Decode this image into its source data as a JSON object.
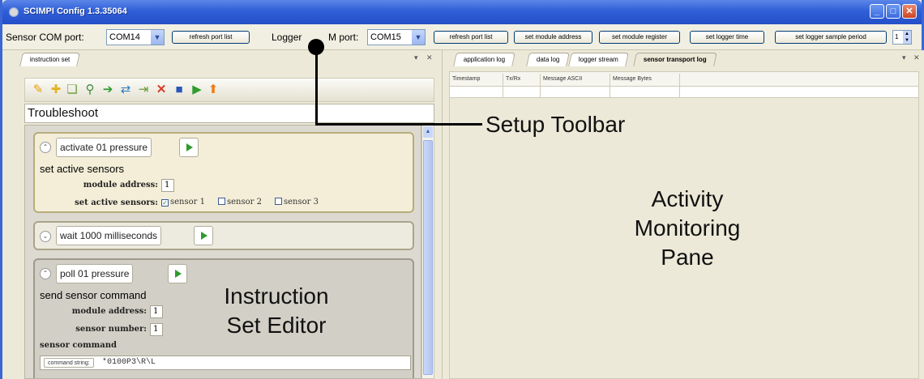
{
  "window": {
    "title": "SCIMPI Config  1.3.35064",
    "minimize": "_",
    "maximize": "□",
    "close": "✕"
  },
  "toolbar": {
    "sensor_port_label": "Sensor COM port:",
    "sensor_port_value": "COM14",
    "refresh1": "refresh port list",
    "logger_port_label_a": "Logger",
    "logger_port_label_b": "M port:",
    "logger_port_value": "COM15",
    "refresh2": "refresh port list",
    "set_module_address": "set module address",
    "set_module_register": "set module register",
    "set_logger_time": "set logger time",
    "set_logger_sample_period": "set logger sample period",
    "sample_period_value": "1"
  },
  "left_pane": {
    "tab": "instruction set",
    "pin": "▾",
    "close": "✕",
    "problem_name": "Troubleshoot",
    "instructions": [
      {
        "name": "activate 01 pressure",
        "type": "set active sensors",
        "module_address_label": "module address:",
        "module_address": "1",
        "active_sensors_label": "set active sensors:",
        "sensors": [
          {
            "label": "sensor 1",
            "checked": true
          },
          {
            "label": "sensor 2",
            "checked": false
          },
          {
            "label": "sensor 3",
            "checked": false
          }
        ],
        "collapse": "⌃"
      },
      {
        "name": "wait 1000 milliseconds",
        "collapse": "⌄"
      },
      {
        "name": "poll 01 pressure",
        "type": "send sensor command",
        "module_address_label": "module address:",
        "module_address": "1",
        "sensor_number_label": "sensor number:",
        "sensor_number": "1",
        "sensor_command_label": "sensor command",
        "command_string_label": "command string:",
        "command_string": "*0100P3\\R\\L",
        "collapse": "⌃"
      }
    ]
  },
  "right_pane": {
    "tabs": [
      "application log",
      "data log",
      "logger stream",
      "sensor transport log"
    ],
    "active_tab": 3,
    "pin": "▾",
    "close": "✕",
    "columns": [
      "Timestamp",
      "Tx/Rx",
      "Message ASCII",
      "Message Bytes"
    ]
  },
  "annotations": {
    "setup_toolbar": "Setup Toolbar",
    "activity_pane": [
      "Activity",
      "Monitoring",
      "Pane"
    ],
    "instruction_editor": [
      "Instruction",
      "Set Editor"
    ]
  },
  "colors": {
    "titlebar": "#2f5fd8",
    "panel": "#ece9d8",
    "play": "#2e9c2e",
    "delete": "#d93b2b"
  },
  "icons": [
    "new-problem-icon",
    "add-instruction-icon",
    "add-set-icon",
    "search-icon",
    "move-right-icon",
    "swap-icon",
    "insert-icon",
    "delete-icon",
    "save-icon",
    "run-icon",
    "upload-icon"
  ]
}
